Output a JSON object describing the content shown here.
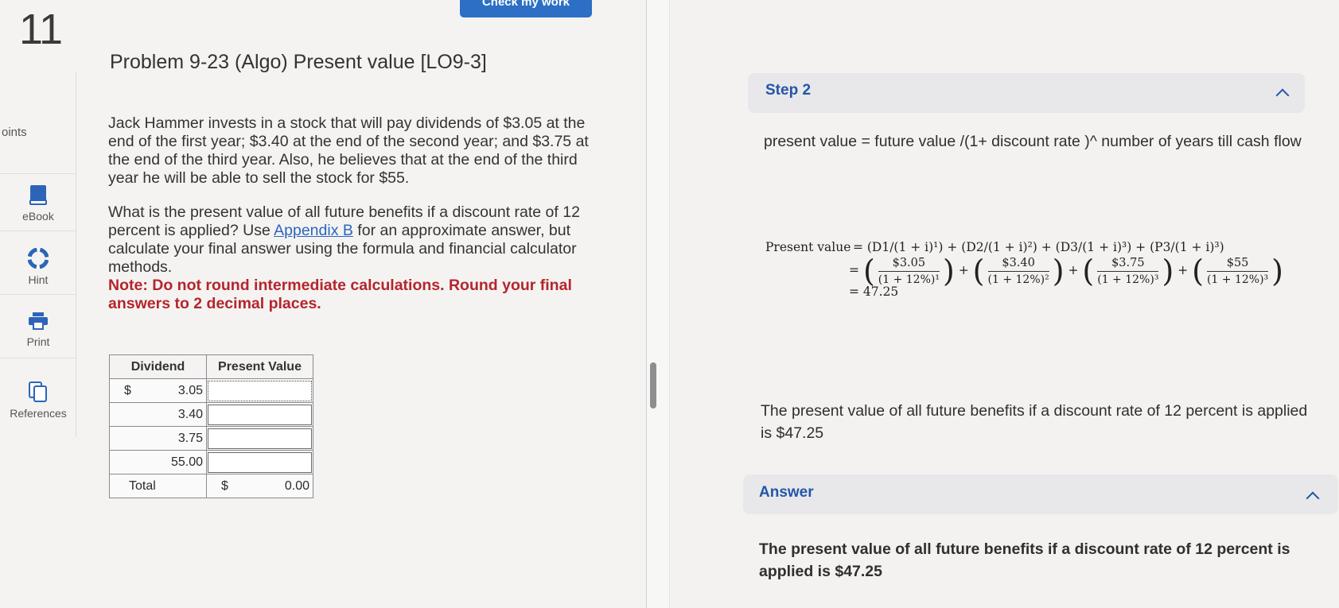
{
  "question_number": "11",
  "check_button": "Check my work",
  "problem": {
    "title": "Problem 9-23 (Algo) Present value [LO9-3]",
    "paragraph1": "Jack Hammer invests in a stock that will pay dividends of $3.05 at the end of the first year; $3.40 at the end of the second year; and $3.75 at the end of the third year. Also, he believes that at the end of the third year he will be able to sell the stock for $55.",
    "paragraph2_before_link": "What is the present value of all future benefits if a discount rate of 12 percent is applied? Use ",
    "link_text": "Appendix B",
    "paragraph2_after_link": " for an approximate answer, but calculate your final answer using the formula and financial calculator methods.",
    "note": "Note: Do not round intermediate calculations. Round your final answers to 2 decimal places."
  },
  "sidebar": {
    "points_label": "oints",
    "items": [
      {
        "label": "eBook",
        "icon": "book-icon"
      },
      {
        "label": "Hint",
        "icon": "lifebuoy-icon"
      },
      {
        "label": "Print",
        "icon": "printer-icon"
      },
      {
        "label": "References",
        "icon": "copy-icon"
      }
    ]
  },
  "table": {
    "headers": [
      "Dividend",
      "Present Value"
    ],
    "rows": [
      {
        "currency": "$",
        "dividend": "3.05"
      },
      {
        "currency": "",
        "dividend": "3.40"
      },
      {
        "currency": "",
        "dividend": "3.75"
      },
      {
        "currency": "",
        "dividend": "55.00"
      }
    ],
    "total_label": "Total",
    "total_currency": "$",
    "total_value": "0.00"
  },
  "solution": {
    "step_label": "Step 2",
    "formula_text": "present value = future value /(1+ discount rate )^ number of years till cash flow",
    "math": {
      "lhs": "Present value",
      "line1": "= (D1/(1 + i)¹) + (D2/(1 + i)²) + (D3/(1 + i)³) + (P3/(1 + i)³)",
      "terms": [
        {
          "num": "$3.05",
          "den": "(1 + 12%)¹"
        },
        {
          "num": "$3.40",
          "den": "(1 + 12%)²"
        },
        {
          "num": "$3.75",
          "den": "(1 + 12%)³"
        },
        {
          "num": "$55",
          "den": "(1 + 12%)³"
        }
      ],
      "result": "= 47.25"
    },
    "result_sentence": "The present value of all future benefits if a discount rate of 12 percent is applied is $47.25",
    "answer_label": "Answer",
    "answer_text": "The present value of all future benefits if a discount rate of 12 percent is applied is $47.25"
  },
  "colors": {
    "accent_blue": "#2455a8",
    "note_red": "#b5252c",
    "button_blue": "#2c6fc4"
  }
}
